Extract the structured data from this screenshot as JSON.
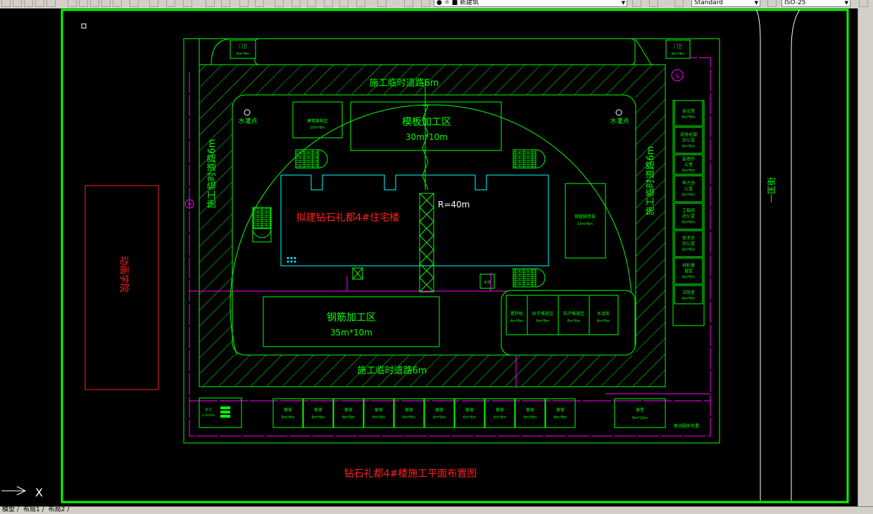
{
  "toolbar": {
    "layer_name": "新建筑",
    "text_style": "Standard",
    "dim_style": "ISO-25"
  },
  "tabs": [
    "模型",
    "布局1",
    "布局2"
  ],
  "colors": {
    "green": "#00ff00",
    "red": "#ff2020",
    "cyan": "#00ffff",
    "magenta": "#ff00ff",
    "white": "#ffffff",
    "background": "#000000"
  },
  "drawing": {
    "title": "钻石礼都4#楼施工平面布置图",
    "neighbor_building": "动画学院",
    "street": "一匡街",
    "road_top": "施工临时道路6m",
    "road_bottom": "施工临时道路6m",
    "road_left": "施工临时道路6m",
    "road_right": "施工临时道路6m",
    "building": "拟建钻石礼都4#住宅楼",
    "crane_radius": "R=40m",
    "gate": "门卫",
    "gate_size": "6m*4m",
    "hydrant": "水灌点",
    "formwork_zone": "模板加工区",
    "formwork_size": "30m*10m",
    "rebar_zone": "钢筋加工区",
    "rebar_size": "35m*10m",
    "steel_stock": "钢管脚手架",
    "steel_stock_size": "15m*8m",
    "waste_zone": "建筑废料区",
    "waste_size": "10m*8m",
    "mixer": "搅拌机",
    "mixer_size": "4m*6m",
    "sand_zone": "砂子堆放区",
    "stone_zone": "石子堆放区",
    "cement": "水泥库",
    "small_size": "6m*6m",
    "dorm": "宿舍",
    "dorm_size": "6m*6m",
    "canteen": "食堂",
    "canteen_size": "6m*10m",
    "toilet": "女工",
    "toilet_size": "3.5m*6m",
    "mobile_toilet": "移动厕所布置",
    "kiln": "水池",
    "offices": [
      {
        "name": "会议室",
        "size": "6m*8m"
      },
      {
        "name": "项目经理办公室",
        "size": "6m*6m"
      },
      {
        "name": "监理办公室",
        "size": "6m*6m"
      },
      {
        "name": "甲方办公室",
        "size": "6m*6m"
      },
      {
        "name": "工程师办公室",
        "size": "6m*6m"
      },
      {
        "name": "技术员办公室",
        "size": "6m*6m"
      },
      {
        "name": "材料管理室",
        "size": "6m*6m"
      },
      {
        "name": "试验室",
        "size": "6m*6m"
      }
    ],
    "axis_label": "X"
  }
}
